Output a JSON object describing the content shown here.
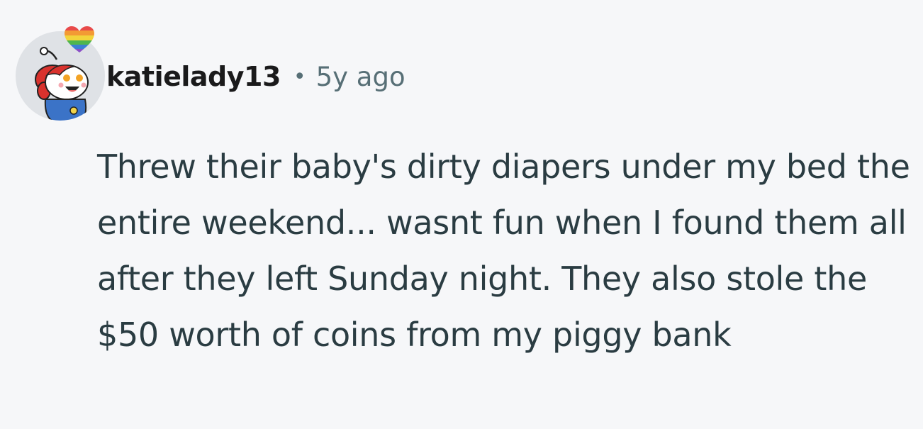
{
  "comment": {
    "username": "katielady13",
    "separator": "•",
    "age": "5y ago",
    "text": "Threw their baby's dirty diapers under my bed the entire weekend... wasnt fun when I found them all after they left Sunday night. They also stole the $50 worth of coins from my piggy bank",
    "avatar_icon": "snoo-avatar-icon",
    "badge_icon": "rainbow-heart-icon"
  },
  "colors": {
    "background": "#f6f7f9",
    "username": "#1a1a1b",
    "meta": "#576f76",
    "body": "#2a3c42"
  }
}
